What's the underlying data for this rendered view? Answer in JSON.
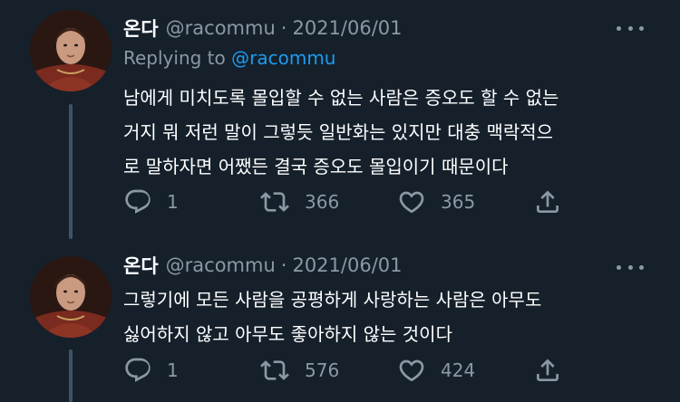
{
  "tweets": [
    {
      "display_name": "온다",
      "handle": "@racommu",
      "separator": "·",
      "date": "2021/06/01",
      "replying_prefix": "Replying to",
      "replying_to": "@racommu",
      "text": "남에게 미치도록 몰입할 수 없는 사람은 증오도 할 수 없는\n거지 뭐 저런 말이 그렇듯 일반화는 있지만 대충 맥락적으\n로 말하자면 어쨌든 결국 증오도 몰입이기 때문이다",
      "replies": "1",
      "retweets": "366",
      "likes": "365",
      "icons": {
        "reply": "reply-icon",
        "retweet": "retweet-icon",
        "like": "heart-icon",
        "share": "share-icon",
        "more": "more-icon"
      }
    },
    {
      "display_name": "온다",
      "handle": "@racommu",
      "separator": "·",
      "date": "2021/06/01",
      "text": "그렇기에 모든 사람을 공평하게 사랑하는 사람은 아무도\n싫어하지 않고 아무도 좋아하지 않는 것이다",
      "replies": "1",
      "retweets": "576",
      "likes": "424",
      "icons": {
        "reply": "reply-icon",
        "retweet": "retweet-icon",
        "like": "heart-icon",
        "share": "share-icon",
        "more": "more-icon"
      }
    }
  ],
  "colors": {
    "background": "#15202b",
    "text": "#ffffff",
    "secondary_text": "#8b98a5",
    "link": "#1d9bf0",
    "thread_line": "#3d5466"
  }
}
